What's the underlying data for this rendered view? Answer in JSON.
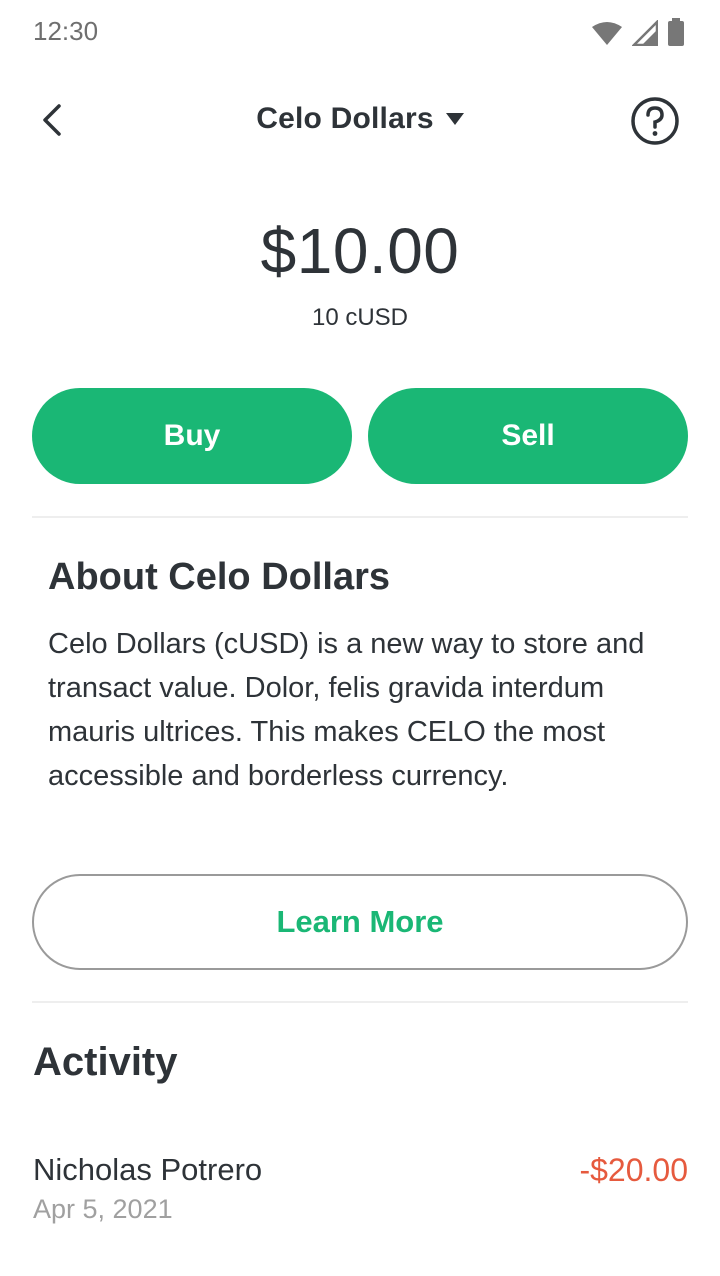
{
  "status_bar": {
    "time": "12:30",
    "icons": [
      "wifi-icon",
      "cellular-signal-icon",
      "battery-icon"
    ]
  },
  "header": {
    "back_icon": "chevron-left-icon",
    "title": "Celo Dollars",
    "dropdown_icon": "caret-down-icon",
    "help_icon": "question-circle-icon"
  },
  "balance": {
    "amount": "$10.00",
    "token_amount": "10 cUSD"
  },
  "actions": {
    "buy_label": "Buy",
    "sell_label": "Sell"
  },
  "about": {
    "title": "About Celo Dollars",
    "body": "Celo Dollars (cUSD) is a new way to store and transact value.  Dolor, felis gravida interdum mauris ultrices. This makes CELO the most accessible and borderless currency.",
    "learn_more_label": "Learn More"
  },
  "activity": {
    "title": "Activity",
    "items": [
      {
        "name": "Nicholas Potrero",
        "date": "Apr 5, 2021",
        "amount": "-$20.00"
      }
    ]
  },
  "colors": {
    "accent_green": "#1ab775",
    "negative_red": "#e65a3e",
    "text_dark": "#2e3338",
    "text_muted": "#a0a0a0"
  }
}
